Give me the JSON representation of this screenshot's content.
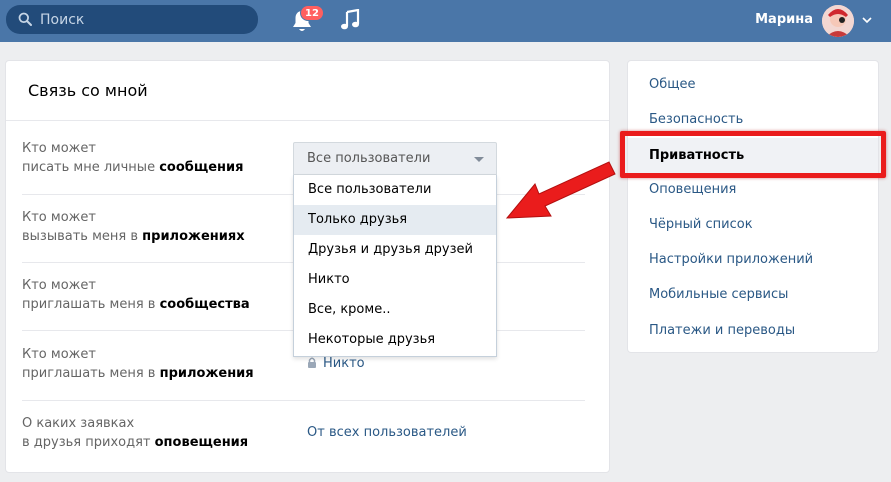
{
  "header": {
    "search_placeholder": "Поиск",
    "notifications_count": "12",
    "user_name": "Марина"
  },
  "settings": {
    "title": "Связь со мной",
    "rows": [
      {
        "label_plain": "Кто может",
        "label_line2": "писать мне личные ",
        "label_bold": "сообщения",
        "value": "Все пользователи"
      },
      {
        "label_plain": "Кто может",
        "label_line2": "вызывать меня в ",
        "label_bold": "приложениях",
        "value": ""
      },
      {
        "label_plain": "Кто может",
        "label_line2": "приглашать меня в ",
        "label_bold": "сообщества",
        "value": ""
      },
      {
        "label_plain": "Кто может",
        "label_line2": "приглашать меня в ",
        "label_bold": "приложения",
        "value": "Никто"
      },
      {
        "label_plain": "О каких заявках",
        "label_line2": "в друзья приходят ",
        "label_bold": "оповещения",
        "value": "От всех пользователей"
      }
    ]
  },
  "dropdown": {
    "selected": "Все пользователи",
    "options": [
      "Все пользователи",
      "Только друзья",
      "Друзья и друзья друзей",
      "Никто",
      "Все, кроме..",
      "Некоторые друзья"
    ],
    "hovered_index": 1
  },
  "nav": {
    "items": [
      "Общее",
      "Безопасность",
      "Приватность",
      "Оповещения",
      "Чёрный список",
      "Настройки приложений",
      "Мобильные сервисы",
      "Платежи и переводы"
    ],
    "active_index": 2
  },
  "colors": {
    "header_bg": "#4a76a8",
    "link": "#2a5885",
    "annotation_red": "#ea1c1c"
  }
}
